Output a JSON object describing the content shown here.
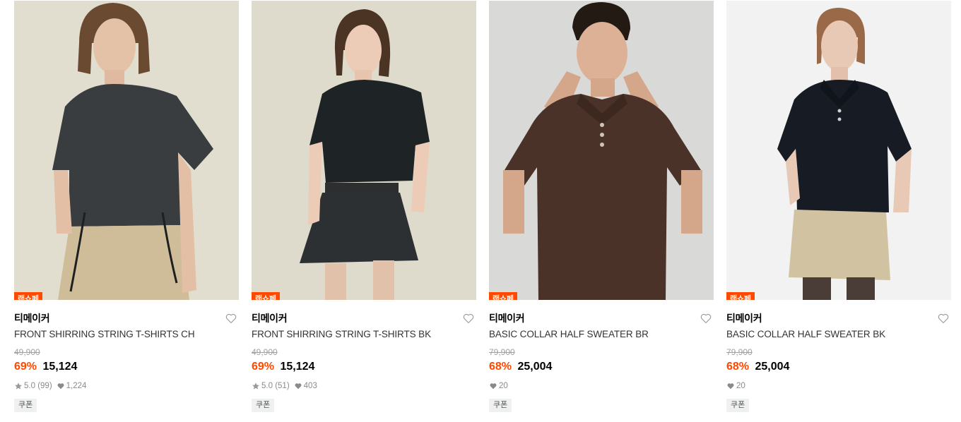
{
  "colors": {
    "accent": "#ff4800",
    "badge_text": "#ffffff"
  },
  "products": [
    {
      "badge": "랜쇼페",
      "brand": "티메이커",
      "name": "FRONT SHIRRING STRING T-SHIRTS CH",
      "original_price": "49,900",
      "discount": "69%",
      "price": "15,124",
      "rating": "5.0",
      "reviews": "(99)",
      "likes": "1,224",
      "coupon": "쿠폰",
      "image_desc": "model in charcoal ruched t-shirt and beige cargo pants",
      "like_icon": "heart-outline-icon"
    },
    {
      "badge": "랜쇼페",
      "brand": "티메이커",
      "name": "FRONT SHIRRING STRING T-SHIRTS BK",
      "original_price": "49,900",
      "discount": "69%",
      "price": "15,124",
      "rating": "5.0",
      "reviews": "(51)",
      "likes": "403",
      "coupon": "쿠폰",
      "image_desc": "model in black t-shirt and pleated mini skirt",
      "like_icon": "heart-outline-icon"
    },
    {
      "badge": "랜쇼페",
      "brand": "티메이커",
      "name": "BASIC COLLAR HALF SWEATER BR",
      "original_price": "79,900",
      "discount": "68%",
      "price": "25,004",
      "rating": "",
      "reviews": "",
      "likes": "20",
      "coupon": "쿠폰",
      "image_desc": "male model in brown knit polo",
      "like_icon": "heart-outline-icon"
    },
    {
      "badge": "랜쇼페",
      "brand": "티메이커",
      "name": "BASIC COLLAR HALF SWEATER BK",
      "original_price": "79,900",
      "discount": "68%",
      "price": "25,004",
      "rating": "",
      "reviews": "",
      "likes": "20",
      "coupon": "쿠폰",
      "image_desc": "model in black knit polo and beige mini skirt",
      "like_icon": "heart-outline-icon"
    }
  ]
}
